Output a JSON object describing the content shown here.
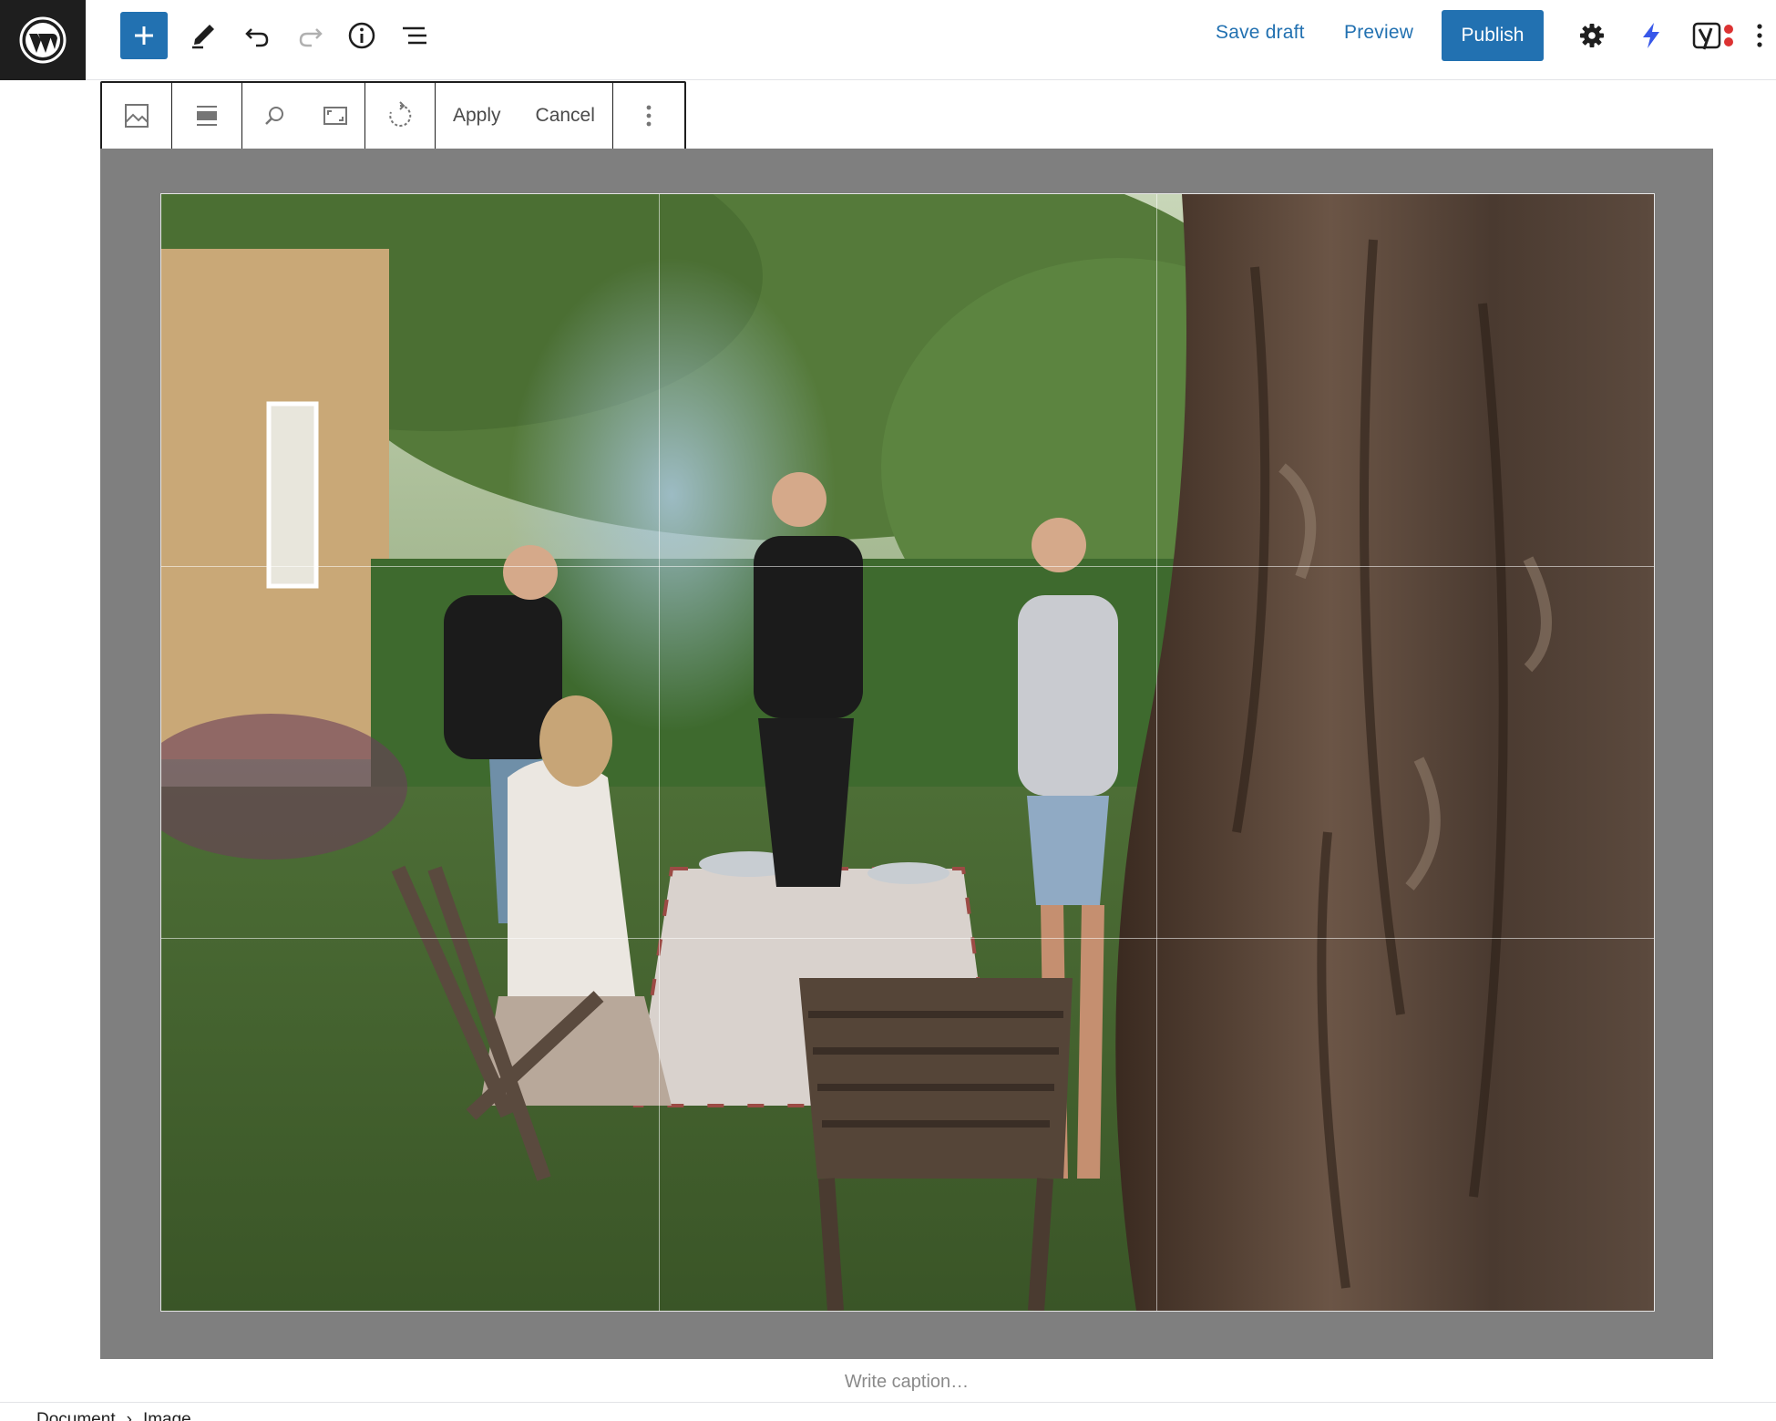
{
  "topbar": {
    "save_draft_label": "Save draft",
    "preview_label": "Preview",
    "publish_label": "Publish",
    "icons": [
      "wordpress-logo-icon",
      "plus-icon",
      "pencil-icon",
      "undo-icon",
      "redo-icon",
      "info-icon",
      "list-view-icon",
      "settings-gear-icon",
      "lightning-icon",
      "yoast-icon",
      "more-vertical-icon"
    ]
  },
  "block_toolbar": {
    "apply_label": "Apply",
    "cancel_label": "Cancel",
    "icons": [
      "image-icon",
      "align-icon",
      "zoom-icon",
      "aspect-ratio-icon",
      "rotate-icon",
      "more-vertical-icon"
    ]
  },
  "image": {
    "description_icon": "garden-dinner-photo",
    "caption_placeholder": "Write caption…"
  },
  "footer": {
    "breadcrumb": [
      "Document",
      "›",
      "Image"
    ]
  },
  "colors": {
    "accent": "#2271b1",
    "logo_bg": "#1e1e1e",
    "stage_bg": "#7f7f7f"
  }
}
